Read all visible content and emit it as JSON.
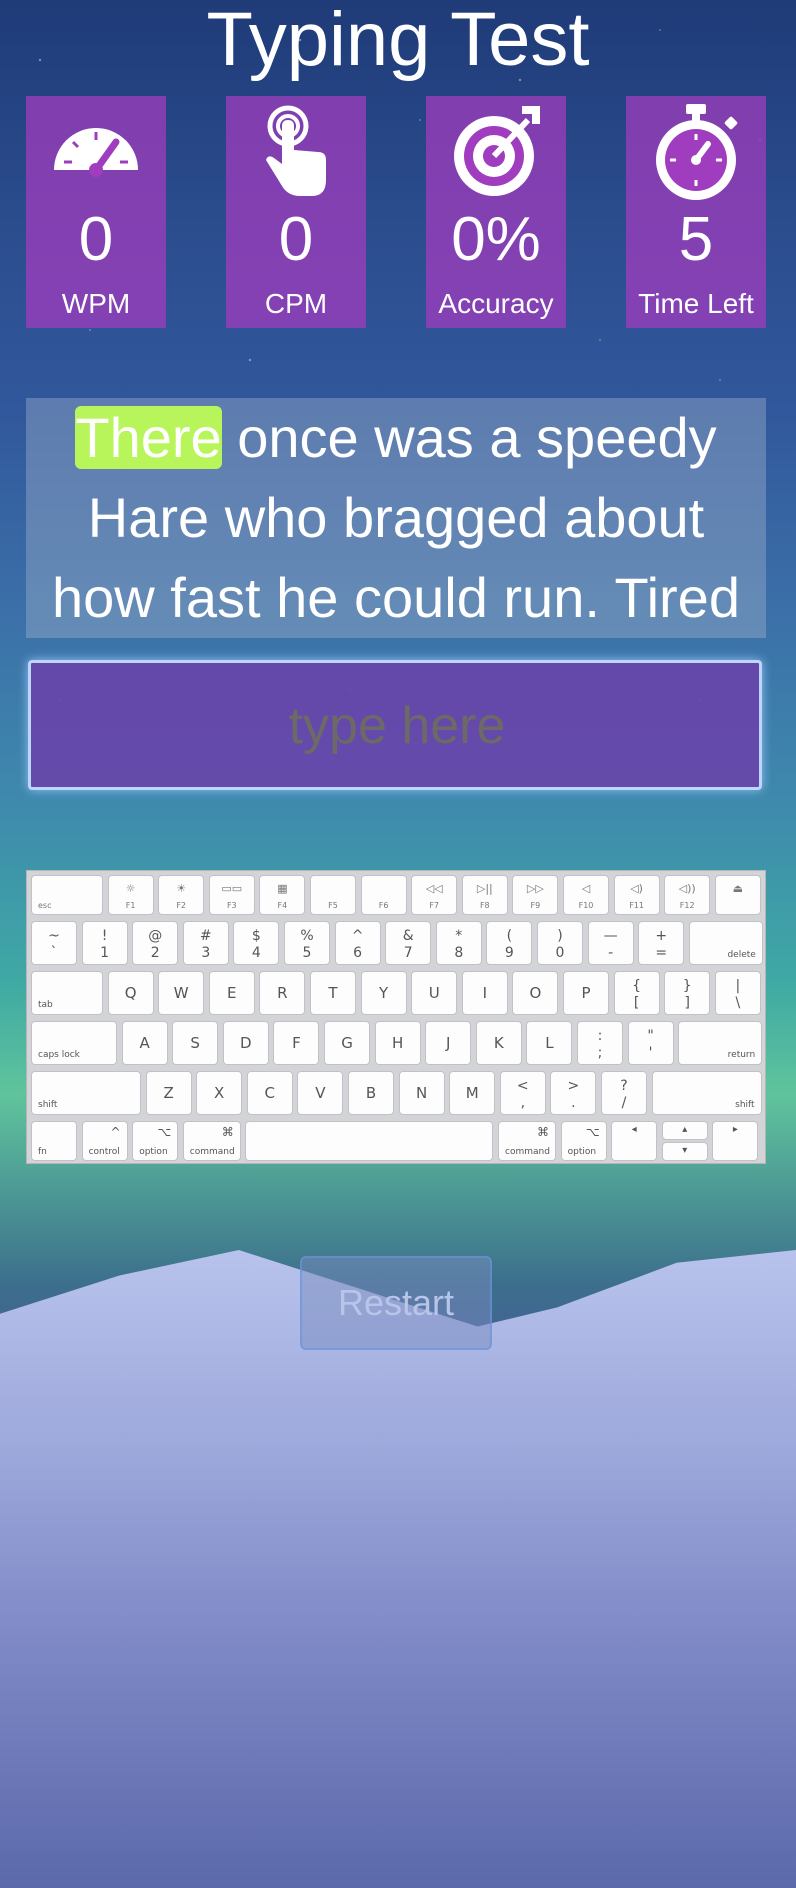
{
  "page": {
    "title": "Typing Test"
  },
  "stats": [
    {
      "value": "0",
      "label": "WPM",
      "icon": "speedometer-icon"
    },
    {
      "value": "0",
      "label": "CPM",
      "icon": "pointer-hand-icon"
    },
    {
      "value": "0%",
      "label": "Accuracy",
      "icon": "target-icon"
    },
    {
      "value": "5",
      "label": "Time Left",
      "icon": "stopwatch-icon"
    }
  ],
  "passage": {
    "current_word": "There",
    "rest_line1": " once was a speedy",
    "line2": "Hare who bragged about",
    "line3": "how fast he could run. Tired"
  },
  "input": {
    "placeholder": "type here",
    "value": ""
  },
  "keyboard": {
    "fn_row": [
      {
        "icon": "",
        "label": "esc"
      },
      {
        "icon": "☼",
        "label": "F1"
      },
      {
        "icon": "☀",
        "label": "F2"
      },
      {
        "icon": "▭▭",
        "label": "F3"
      },
      {
        "icon": "▦",
        "label": "F4"
      },
      {
        "icon": "",
        "label": "F5"
      },
      {
        "icon": "",
        "label": "F6"
      },
      {
        "icon": "◁◁",
        "label": "F7"
      },
      {
        "icon": "▷||",
        "label": "F8"
      },
      {
        "icon": "▷▷",
        "label": "F9"
      },
      {
        "icon": "◁",
        "label": "F10"
      },
      {
        "icon": "◁)",
        "label": "F11"
      },
      {
        "icon": "◁))",
        "label": "F12"
      },
      {
        "icon": "⏏",
        "label": ""
      }
    ],
    "number_row": [
      {
        "top": "~",
        "bottom": "`"
      },
      {
        "top": "!",
        "bottom": "1"
      },
      {
        "top": "@",
        "bottom": "2"
      },
      {
        "top": "#",
        "bottom": "3"
      },
      {
        "top": "$",
        "bottom": "4"
      },
      {
        "top": "%",
        "bottom": "5"
      },
      {
        "top": "^",
        "bottom": "6"
      },
      {
        "top": "&",
        "bottom": "7"
      },
      {
        "top": "*",
        "bottom": "8"
      },
      {
        "top": "(",
        "bottom": "9"
      },
      {
        "top": ")",
        "bottom": "0"
      },
      {
        "top": "—",
        "bottom": "-"
      },
      {
        "top": "+",
        "bottom": "="
      },
      {
        "top": "",
        "bottom": "delete"
      }
    ],
    "qwerty_row": [
      "tab",
      "Q",
      "W",
      "E",
      "R",
      "T",
      "Y",
      "U",
      "I",
      "O",
      "P",
      "{ [",
      "} ]",
      "| \\"
    ],
    "home_row": [
      "caps lock",
      "A",
      "S",
      "D",
      "F",
      "G",
      "H",
      "J",
      "K",
      "L",
      ": ;",
      "\" '",
      "return"
    ],
    "bottom_row": [
      "shift",
      "Z",
      "X",
      "C",
      "V",
      "B",
      "N",
      "M",
      "< ,",
      "> .",
      "? /",
      "shift"
    ],
    "mod_row": [
      {
        "top": "",
        "label": "fn"
      },
      {
        "top": "^",
        "label": "control"
      },
      {
        "top": "⌥",
        "label": "option"
      },
      {
        "top": "⌘",
        "label": "command"
      },
      {
        "top": "",
        "label": ""
      },
      {
        "top": "⌘",
        "label": "command"
      },
      {
        "top": "⌥",
        "label": "option"
      },
      {
        "top": "◂",
        "label": ""
      },
      {
        "top": "▴",
        "label": ""
      },
      {
        "top": "▾",
        "label": ""
      },
      {
        "top": "▸",
        "label": ""
      }
    ]
  },
  "restart": {
    "label": "Restart"
  },
  "colors": {
    "stat_bg": "#a03cbe",
    "highlight": "#b8f55a",
    "text": "#ffffff"
  }
}
